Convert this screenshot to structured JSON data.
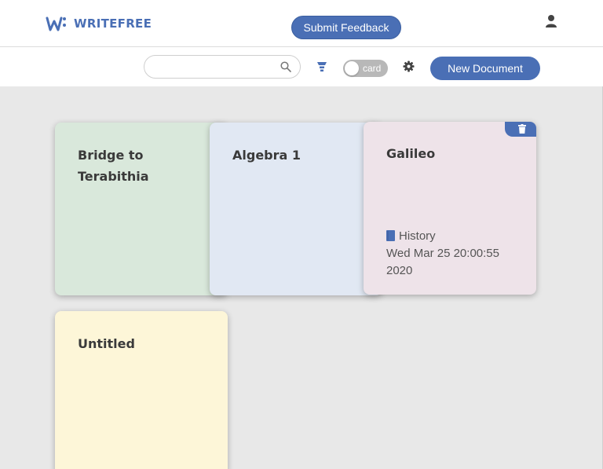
{
  "app": {
    "brand_name": "WRITEFREE",
    "accent_color": "#4a6fb5"
  },
  "header": {
    "feedback_label": "Submit Feedback",
    "user_icon": "user-icon"
  },
  "toolbar": {
    "search": {
      "value": "",
      "placeholder": ""
    },
    "filter_icon": "filter-icon",
    "view_toggle_label": "card",
    "settings_icon": "gear-icon",
    "new_document_label": "New Document"
  },
  "documents": [
    {
      "title": "Bridge to Terabithia",
      "color": "#d9e8db"
    },
    {
      "title": "Algebra 1",
      "color": "#e1e8f3"
    },
    {
      "title": "Galileo",
      "color": "#eee3e9",
      "subject": "History",
      "date": "Wed Mar 25 20:00:55 2020",
      "hovered": true
    },
    {
      "title": "Untitled",
      "color": "#fdf6d8"
    }
  ]
}
